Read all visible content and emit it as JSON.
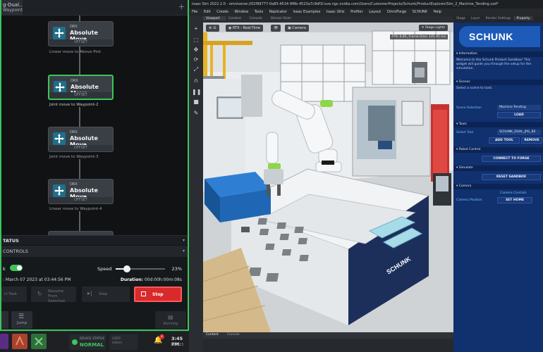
{
  "left_panel": {
    "tab_title": "g-Dual...",
    "tab_subtitle": "Waypoint-2",
    "add_tab": "+",
    "nodes": [
      {
        "kind": "ORX",
        "title": "Absolute Move",
        "offset": "OFFSET",
        "desc": "Linear move to Above Pick"
      },
      {
        "kind": "ORX",
        "title": "Absolute Move",
        "offset": "OFFSET",
        "desc": "Joint move to Waypoint-2"
      },
      {
        "kind": "ORX",
        "title": "Absolute Move",
        "offset": "OFFSET",
        "desc": "Joint move to Waypoint-3"
      },
      {
        "kind": "ORX",
        "title": "Absolute Move",
        "offset": "OFFSET",
        "desc": "Linear move to Waypoint-4"
      }
    ],
    "status_header": "TATUS",
    "controls_header": "CONTROLS",
    "controls": {
      "toggle_label": "k",
      "toggle_on": true,
      "speed_label": "Speed",
      "speed_value": "23%",
      "speed_fraction": 0.23,
      "date_text": ": March 07 2023 at 03:44:56 PM",
      "duration_label": "Duration:",
      "duration_value": "00d:00h:00m:08s",
      "start_label": "rt Task",
      "resume_label": "Resume From Selected",
      "step_label": "Step",
      "stop_label": "Stop",
      "jump_label": "Jump",
      "running_label": "Running"
    }
  },
  "taskbar": {
    "device_status_label": "DEVICE STATUS",
    "device_status_value": "NORMAL",
    "user_line1": "USER",
    "user_line2": "Admin",
    "notification_count": "2",
    "time": "3:45 PM",
    "date": "3/7/23"
  },
  "sim": {
    "title": "Isaac Sim 2022.2.0 - omniverse://02f99777-0a83-4514-9f6b-4523a7c9df1f.ove.ngc.nvidia.com/Users/CustomerProjects/Schunk/ProductExplorer/Sim_2_Machine_Tending.usd*",
    "menu": [
      "File",
      "Edit",
      "Create",
      "Window",
      "Tools",
      "Replicator",
      "Isaac Examples",
      "Isaac Utils",
      "Profiler",
      "Layout",
      "OmniForge",
      "SCHUNK",
      "Help"
    ],
    "viewport_tabs": [
      "Viewport",
      "Content",
      "Console",
      "Stream Stats"
    ],
    "viewport_toolbar": {
      "render_mode": "RTX - Real-Time",
      "camera": "Camera",
      "stage_lights": "Stage Lights",
      "fps": "FPS: 6.85, Frame time: 145.95 ms"
    },
    "bottom_tabs": [
      "Content",
      "Console"
    ],
    "right_tabs": [
      "Stage",
      "Layer",
      "Render Settings",
      "Property"
    ],
    "panel": {
      "logo": "SCHUNK",
      "sections": {
        "information": "Information",
        "information_text": "Welcome to the Schunk Product Sandbox! This widget will guide you through the setup for the simulation.",
        "scenes": "Scenes",
        "scenes_text": "Select a scene to load.",
        "scene_selection_label": "Scene Selection",
        "scene_selection_value": "Machine Tending",
        "load_button": "LOAD",
        "tools": "Tools",
        "select_tool_label": "Select Tool",
        "select_tool_value": "SCHUNK_DUAL_JPG_80",
        "add_tool_button": "ADD TOOL",
        "remove_tool_button": "REMOVE",
        "robot_control": "Robot Control",
        "connect_button": "CONNECT TO FORGE",
        "simulate": "Simulate",
        "reset_button": "RESET SANDBOX",
        "camera": "Camera",
        "camera_controls": "Camera Controls",
        "camera_position_label": "Camera Position",
        "set_home_button": "SET HOME"
      }
    },
    "scene_brand": "SCHUNK"
  }
}
